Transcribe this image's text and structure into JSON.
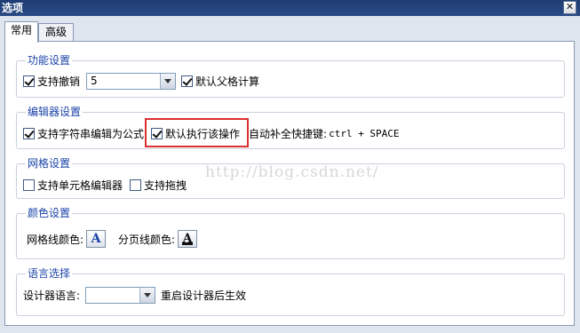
{
  "window": {
    "title": "选项",
    "close_glyph": "✕"
  },
  "tabs": [
    {
      "label": "常用",
      "active": true
    },
    {
      "label": "高级",
      "active": false
    }
  ],
  "sections": {
    "function": {
      "legend": "功能设置",
      "undo": {
        "label": "支持撤销",
        "checked": true
      },
      "undo_combo_value": "5",
      "parent_calc": {
        "label": "默认父格计算",
        "checked": true
      }
    },
    "editor": {
      "legend": "编辑器设置",
      "formula": {
        "label": "支持字符串编辑为公式",
        "checked": true
      },
      "default_exec": {
        "label": "默认执行该操作",
        "checked": true
      },
      "autocomplete_label": "自动补全快捷键:",
      "shortcut": "ctrl + SPACE"
    },
    "grid": {
      "legend": "网格设置",
      "cell_editor": {
        "label": "支持单元格编辑器",
        "checked": false
      },
      "drag": {
        "label": "支持拖拽",
        "checked": false
      }
    },
    "color": {
      "legend": "颜色设置",
      "gridline_label": "网格线颜色:",
      "pageline_label": "分页线颜色:",
      "glyph": "A"
    },
    "language": {
      "legend": "语言选择",
      "designer_lang_label": "设计器语言:",
      "combo_value": "",
      "restart_note": "重启设计器后生效"
    }
  },
  "watermark": "http://blog.csdn.net/",
  "colors": {
    "accent": "#1b43a8",
    "highlight": "#d9312f"
  }
}
